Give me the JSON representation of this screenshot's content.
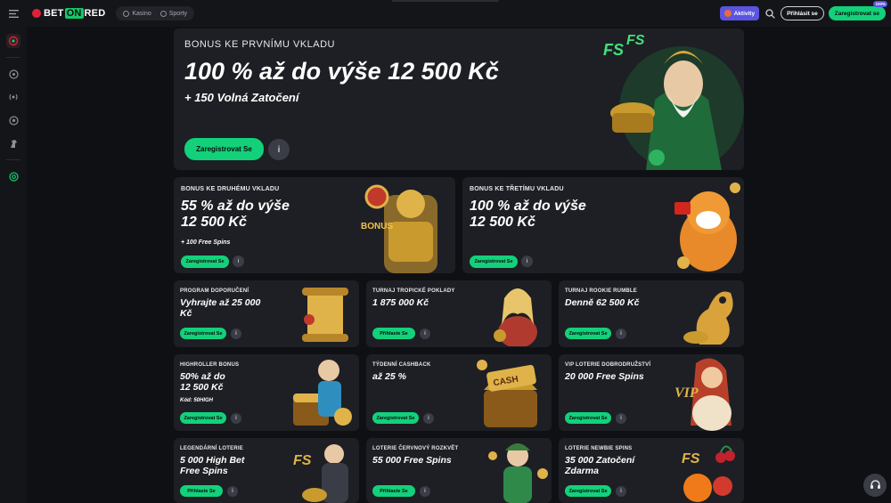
{
  "header": {
    "menu_icon": "hamburger-icon",
    "logo": {
      "part1": "BET",
      "part2": "ON",
      "part3": "RED"
    },
    "mode_tabs": [
      {
        "label": "Kasino",
        "icon": "casino-icon"
      },
      {
        "label": "Sporty",
        "icon": "sport-icon"
      }
    ],
    "activity_label": "Aktivity",
    "login_label": "Přihlásit se",
    "register_label": "Zaregistrovat se",
    "register_badge": "100%"
  },
  "sidebar": {
    "items": [
      {
        "icon": "slots-icon"
      },
      {
        "icon": "roulette-icon"
      },
      {
        "icon": "live-icon"
      },
      {
        "icon": "football-icon"
      },
      {
        "icon": "horse-racing-icon"
      },
      {
        "icon": "support-icon"
      }
    ]
  },
  "hero": {
    "eyebrow": "BONUS KE PRVNÍMU VKLADU",
    "headline": "100 % až do výše 12 500 Kč",
    "sub": "+ 150 Volná Zatočení",
    "cta": "Zaregistrovat Se"
  },
  "mid_cards": [
    {
      "eyebrow": "BONUS KE DRUHÉMU VKLADU",
      "headline_l1": "55 % až do výše",
      "headline_l2": "12 500 Kč",
      "sub": "+ 100 Free Spins",
      "cta": "Zaregistrovat Se"
    },
    {
      "eyebrow": "BONUS KE TŘETÍMU VKLADU",
      "headline_l1": "100 % až do výše",
      "headline_l2": "12 500 Kč",
      "sub": "",
      "cta": "Zaregistrovat Se"
    }
  ],
  "small_cards": [
    {
      "eyebrow": "PROGRAM DOPORUČENÍ",
      "l1": "Vyhrajte až 25 000",
      "l2": "Kč",
      "sub": "",
      "cta": "Zaregistrovat Se"
    },
    {
      "eyebrow": "TURNAJ TROPICKÉ POKLADY",
      "l1": "1 875 000 Kč",
      "l2": "",
      "sub": "",
      "cta": "Přihlaste Se"
    },
    {
      "eyebrow": "TURNAJ ROOKIE RUMBLE",
      "l1": "Denně 62 500 Kč",
      "l2": "",
      "sub": "",
      "cta": "Zaregistrovat Se"
    },
    {
      "eyebrow": "HIGHROLLER BONUS",
      "l1": "50% až do",
      "l2": "12 500 Kč",
      "sub": "Kód: 50HIGH",
      "cta": "Zaregistrovat Se"
    },
    {
      "eyebrow": "TÝDENNÍ CASHBACK",
      "l1": "až 25 %",
      "l2": "",
      "sub": "",
      "cta": "Zaregistrovat Se"
    },
    {
      "eyebrow": "VIP LOTERIE DOBRODRUŽSTVÍ",
      "l1": "20 000 Free Spins",
      "l2": "",
      "sub": "",
      "cta": "Zaregistrovat Se"
    },
    {
      "eyebrow": "LEGENDÁRNÍ LOTERIE",
      "l1": "5 000 High Bet",
      "l2": "Free Spins",
      "sub": "",
      "cta": "Přihlaste Se"
    },
    {
      "eyebrow": "LOTERIE ČERVNOVÝ ROZKVĚT",
      "l1": "55 000 Free Spins",
      "l2": "",
      "sub": "",
      "cta": "Přihlaste Se"
    },
    {
      "eyebrow": "LOTERIE NEWBIE SPINS",
      "l1": "35 000 Zatočení",
      "l2": "Zdarma",
      "sub": "",
      "cta": "Zaregistrovat Se"
    }
  ],
  "info_glyph": "i",
  "colors": {
    "accent": "#12d17a",
    "brand_red": "#e0213a",
    "activity": "#5b54e0",
    "card": "#1d1f24",
    "bg": "#0f1013"
  }
}
